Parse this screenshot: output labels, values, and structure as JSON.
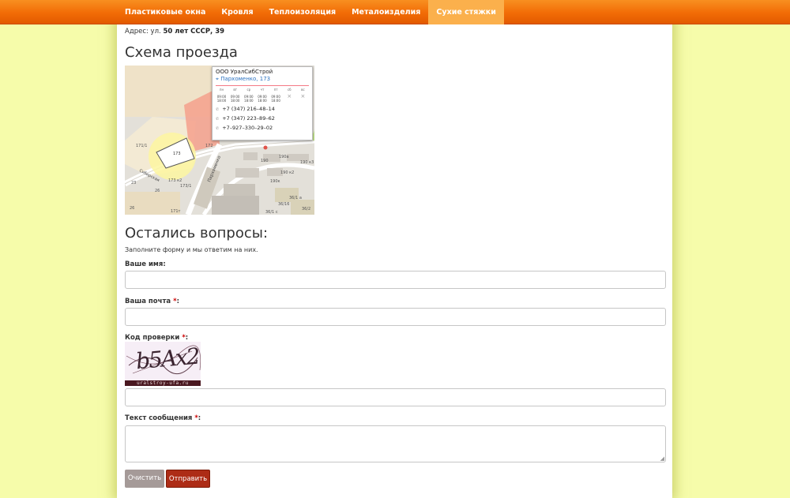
{
  "nav": {
    "items": [
      "Пластиковые окна",
      "Кровля",
      "Теплоизоляция",
      "Металоизделия",
      "Сухие стяжки"
    ],
    "active_index": 4
  },
  "address": {
    "prefix": "Адрес: ул.",
    "value": "50 лет СССР, 39"
  },
  "map_section": {
    "title": "Схема проезда",
    "balloon": {
      "company": "ООО  УралСибСтрой",
      "address": "Пархоменко, 173",
      "days": [
        "пн",
        "вт",
        "ср",
        "чт",
        "пт",
        "сб",
        "вс"
      ],
      "hours": [
        "09:00 18:00",
        "09:00 18:00",
        "09:00 18:00",
        "09:00 18:00",
        "09:00 18:00",
        "×",
        "×"
      ],
      "phones": [
        "+7 (347) 216–48–14",
        "+7 (347) 223–89–62",
        "+7–927–330–29–02"
      ]
    },
    "labels": {
      "street": "Пархоменко",
      "street2": "Сибирская",
      "b1": "173",
      "b2": "171/1",
      "b3": "172",
      "b4": "190а",
      "b5": "190",
      "b6": "190 к2",
      "b7": "190 к3",
      "b8": "190к",
      "b9": "36/1 а",
      "b10": "36/16",
      "b11": "36/2",
      "b12": "36/1 с",
      "b13": "173 к2",
      "b14": "26",
      "b15": "26",
      "b16": "171т",
      "b17": "23",
      "b18": "173/1"
    }
  },
  "form": {
    "title": "Остались вопросы:",
    "intro": "Заполните форму и мы ответим на них.",
    "required_mark": "*",
    "name_label": "Ваше имя:",
    "email_label": "Ваша почта",
    "captcha_label": "Код проверки",
    "message_label": "Текст сообщения",
    "label_suffix": ":",
    "captcha_text": "b5Ax2",
    "captcha_site": "uralstroy-ufa.ru",
    "reset_label": "Очистить",
    "submit_label": "Отправить"
  },
  "colors": {
    "nav_orange": "#f26c06",
    "nav_active": "#fbb04c",
    "background": "#f6fcaa",
    "submit": "#ad2c16",
    "reset": "#a59a98"
  }
}
